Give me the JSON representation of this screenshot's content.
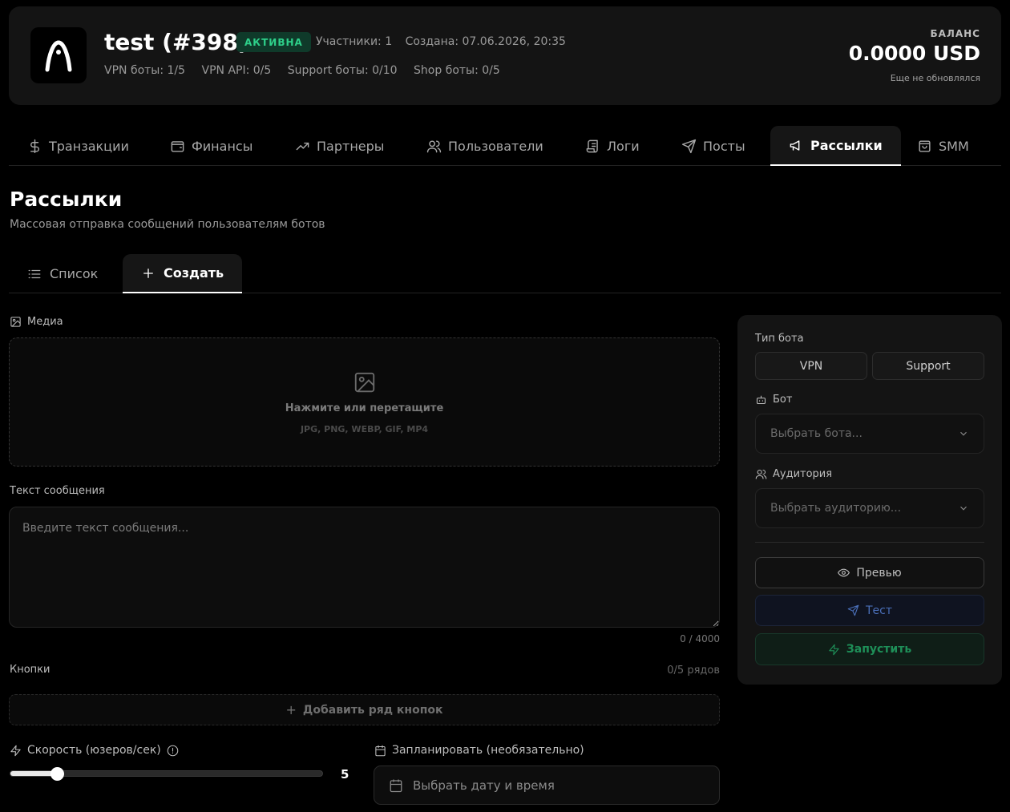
{
  "header": {
    "title": "test (#398)",
    "status_badge": "АКТИВНА",
    "members": "Участники: 1",
    "created": "Создана: 07.06.2026, 20:35",
    "limits": [
      "VPN боты: 1/5",
      "VPN API: 0/5",
      "Support боты: 0/10",
      "Shop боты: 0/5"
    ],
    "balance_label": "БАЛАНС",
    "balance_value": "0.0000 USD",
    "balance_sub": "Еще не обновлялся"
  },
  "tabs": [
    {
      "label": "Транзакции",
      "icon": "dollar-icon"
    },
    {
      "label": "Финансы",
      "icon": "wallet-icon"
    },
    {
      "label": "Партнеры",
      "icon": "trending-up-icon"
    },
    {
      "label": "Пользователи",
      "icon": "users-icon"
    },
    {
      "label": "Логи",
      "icon": "scroll-icon"
    },
    {
      "label": "Посты",
      "icon": "send-icon"
    },
    {
      "label": "Рассылки",
      "icon": "megaphone-icon",
      "active": true
    },
    {
      "label": "SMM",
      "icon": "shopping-bag-icon"
    }
  ],
  "page": {
    "title": "Рассылки",
    "subtitle": "Массовая отправка сообщений пользователям ботов"
  },
  "subtabs": [
    {
      "label": "Список",
      "icon": "list-icon"
    },
    {
      "label": "Создать",
      "icon": "plus-icon",
      "active": true
    }
  ],
  "form": {
    "media_label": "Медиа",
    "dropzone_title": "Нажмите или перетащите",
    "dropzone_formats": "JPG, PNG, WEBP, GIF, MP4",
    "message_label": "Текст сообщения",
    "message_placeholder": "Введите текст сообщения...",
    "message_value": "",
    "message_counter": "0 / 4000",
    "buttons_label": "Кнопки",
    "buttons_count": "0/5 рядов",
    "add_row_label": "Добавить ряд кнопок",
    "speed_label": "Скорость (юзеров/сек)",
    "speed_value": "5",
    "speed_fraction": 0.15,
    "schedule_label": "Запланировать (необязательно)",
    "schedule_button": "Выбрать дату и время"
  },
  "panel": {
    "bot_type_label": "Тип бота",
    "bot_type_options": [
      "VPN",
      "Support"
    ],
    "bot_label": "Бот",
    "bot_placeholder": "Выбрать бота...",
    "audience_label": "Аудитория",
    "audience_placeholder": "Выбрать аудиторию...",
    "preview_button": "Превью",
    "test_button": "Тест",
    "launch_button": "Запустить"
  },
  "colors": {
    "background": "#000000",
    "card": "#141414",
    "badge_bg": "#0f3a2a",
    "badge_text": "#2ed08a",
    "test_accent": "#4a6fb8",
    "launch_accent": "#1e8f58"
  }
}
